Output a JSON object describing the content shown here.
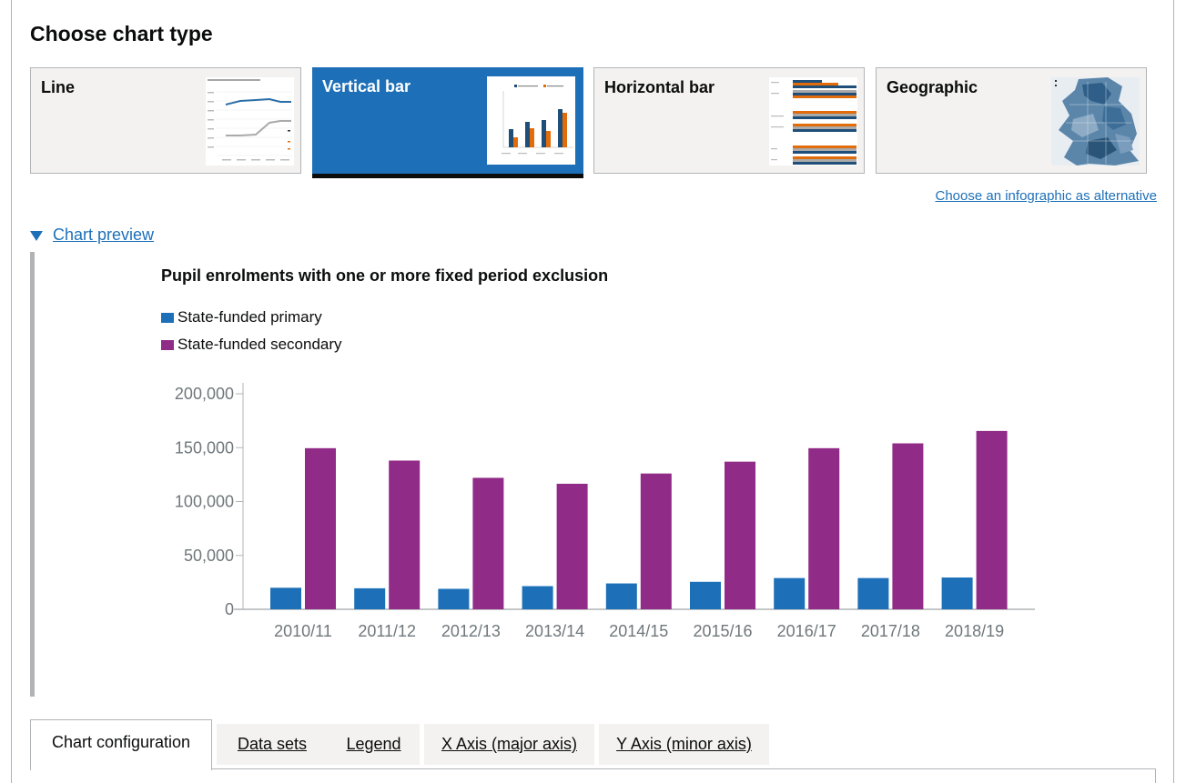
{
  "heading": "Choose chart type",
  "chart_types": [
    {
      "label": "Line",
      "selected": false,
      "thumbnail": "line-chart-thumbnail"
    },
    {
      "label": "Vertical bar",
      "selected": true,
      "thumbnail": "vertical-bar-chart-thumbnail"
    },
    {
      "label": "Horizontal bar",
      "selected": false,
      "thumbnail": "horizontal-bar-chart-thumbnail"
    },
    {
      "label": "Geographic",
      "selected": false,
      "thumbnail": "geographic-map-thumbnail"
    }
  ],
  "infographic_link": "Choose an infographic as alternative",
  "preview_toggle": "Chart preview",
  "colors": {
    "primary": "#1d70b8",
    "secondary": "#912b88",
    "selected_card": "#1d70b8",
    "link": "#1d70b8"
  },
  "chart_data": {
    "type": "bar",
    "title": "Pupil enrolments with one or more fixed period exclusion",
    "categories": [
      "2010/11",
      "2011/12",
      "2012/13",
      "2013/14",
      "2014/15",
      "2015/16",
      "2016/17",
      "2017/18",
      "2018/19"
    ],
    "series": [
      {
        "name": "State-funded primary",
        "color": "#1d70b8",
        "values": [
          20000,
          19500,
          19000,
          21500,
          24000,
          25500,
          29000,
          29000,
          29500
        ]
      },
      {
        "name": "State-funded secondary",
        "color": "#912b88",
        "values": [
          149500,
          138000,
          122000,
          116500,
          126000,
          137000,
          149500,
          154000,
          165500
        ]
      }
    ],
    "ylim": [
      0,
      200000
    ],
    "yticks": [
      "0",
      "50,000",
      "100,000",
      "150,000",
      "200,000"
    ],
    "ytick_values": [
      0,
      50000,
      100000,
      150000,
      200000
    ],
    "legend": "top-left",
    "grid": false
  },
  "tabs": [
    {
      "label": "Chart configuration",
      "active": true
    },
    {
      "label": "Data sets",
      "active": false
    },
    {
      "label": "Legend",
      "active": false
    },
    {
      "label": "X Axis (major axis)",
      "active": false
    },
    {
      "label": "Y Axis (minor axis)",
      "active": false
    }
  ]
}
